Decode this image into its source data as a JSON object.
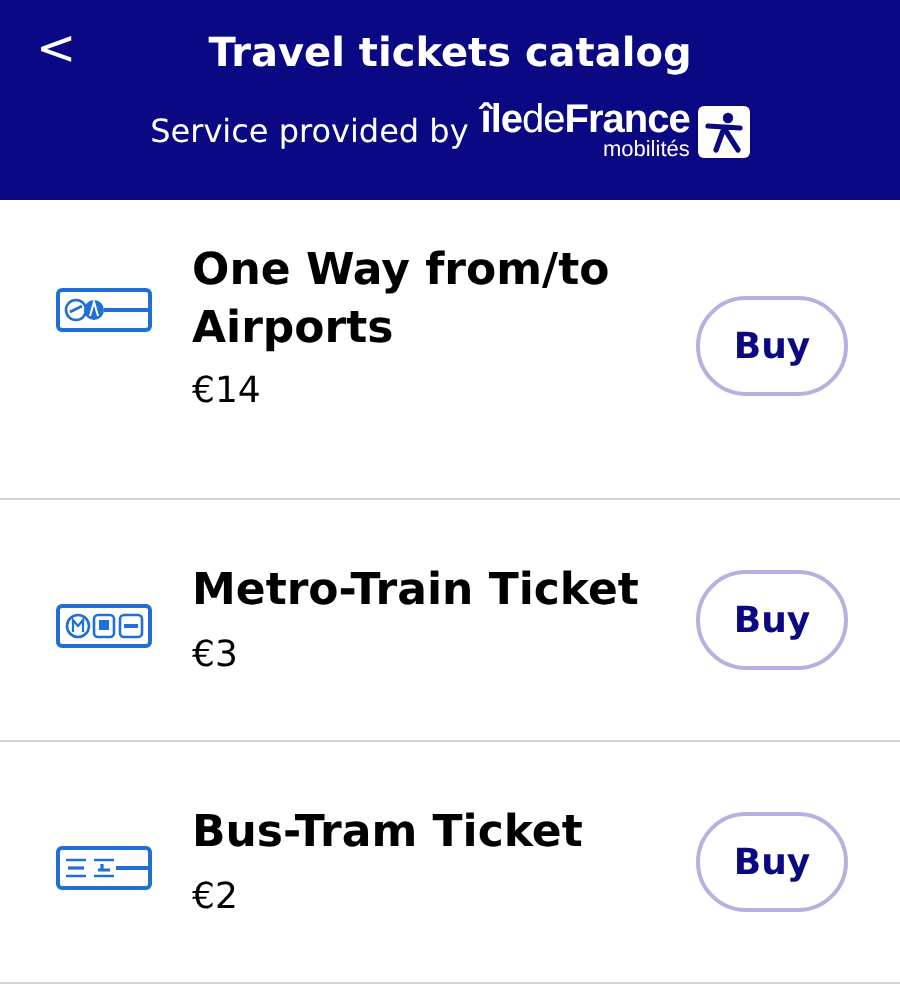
{
  "header": {
    "back": "<",
    "title": "Travel tickets catalog",
    "subtitle": "Service provided by",
    "logo_name": "**île**de**France**",
    "logo_sub": "mobilités"
  },
  "tickets": [
    {
      "kind": "airport",
      "name": "One Way from/to Airports",
      "price": "€14",
      "button": "Buy"
    },
    {
      "kind": "metro",
      "name": "Metro-Train Ticket",
      "price": "€3",
      "button": "Buy"
    },
    {
      "kind": "bus",
      "name": "Bus-Tram Ticket",
      "price": "€2",
      "button": "Buy"
    }
  ]
}
